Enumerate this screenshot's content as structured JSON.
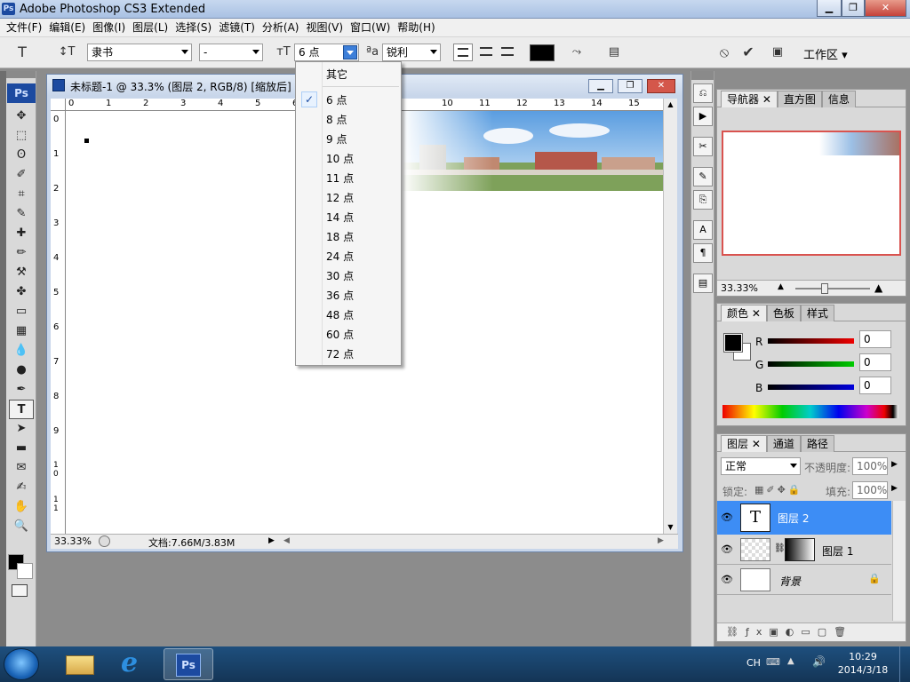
{
  "window": {
    "title": "Adobe Photoshop CS3 Extended",
    "ps_badge": "Ps",
    "btn_min": "▁",
    "btn_max": "❐",
    "btn_close": "✕"
  },
  "menu": [
    "文件(F)",
    "编辑(E)",
    "图像(I)",
    "图层(L)",
    "选择(S)",
    "滤镜(T)",
    "分析(A)",
    "视图(V)",
    "窗口(W)",
    "帮助(H)"
  ],
  "options": {
    "tool_glyph": "T",
    "orient_glyph": "↕T",
    "font_family": "隶书",
    "font_style": "-",
    "size_glyph": "ᴛT",
    "font_size": "6 点",
    "aa_glyph": "ªa",
    "antialias": "锐利",
    "text_color": "#000000",
    "workspace": "工作区"
  },
  "size_menu": {
    "header": "其它",
    "items": [
      "6 点",
      "8 点",
      "9 点",
      "10 点",
      "11 点",
      "12 点",
      "14 点",
      "18 点",
      "24 点",
      "30 点",
      "36 点",
      "48 点",
      "60 点",
      "72 点"
    ],
    "checkmark": "✓"
  },
  "document": {
    "title": "未标题-1 @ 33.3% (图层 2, RGB/8) [缩放后]",
    "zoom": "33.33%",
    "doc_info": "文档:7.66M/3.83M",
    "ruler_h": [
      "0",
      "1",
      "2",
      "3",
      "4",
      "5",
      "6",
      "10",
      "11",
      "12",
      "13",
      "14",
      "15"
    ],
    "ruler_v": [
      "0",
      "1",
      "2",
      "3",
      "4",
      "5",
      "6",
      "7",
      "8",
      "9",
      "1\n0",
      "1\n1"
    ]
  },
  "toolbox": {
    "badge": "Ps",
    "tools": [
      "✥",
      "⬚",
      "ʘ",
      "✐",
      "⌗",
      "✎",
      "✚",
      "✏",
      "⚒",
      "✤",
      "▭",
      "▦",
      "💧",
      "●",
      "✒",
      "T",
      "➤",
      "▬",
      "✉",
      "✍",
      "✋",
      "🔍"
    ]
  },
  "navigator": {
    "tabs": [
      "导航器",
      "直方图",
      "信息"
    ],
    "zoom": "33.33%"
  },
  "color_panel": {
    "tabs": [
      "颜色",
      "色板",
      "样式"
    ],
    "labels": [
      "R",
      "G",
      "B"
    ],
    "values": [
      "0",
      "0",
      "0"
    ]
  },
  "layers_panel": {
    "tabs": [
      "图层",
      "通道",
      "路径"
    ],
    "blend_mode": "正常",
    "opacity_label": "不透明度:",
    "opacity": "100%",
    "lock_label": "锁定:",
    "fill_label": "填充:",
    "fill": "100%",
    "layers": [
      {
        "name": "图层 2",
        "thumb": "T"
      },
      {
        "name": "图层 1"
      },
      {
        "name": "背景"
      }
    ]
  },
  "taskbar": {
    "lang": "CH",
    "time": "10:29",
    "date": "2014/3/18",
    "ps_label": "Ps",
    "ie_label": "e"
  }
}
